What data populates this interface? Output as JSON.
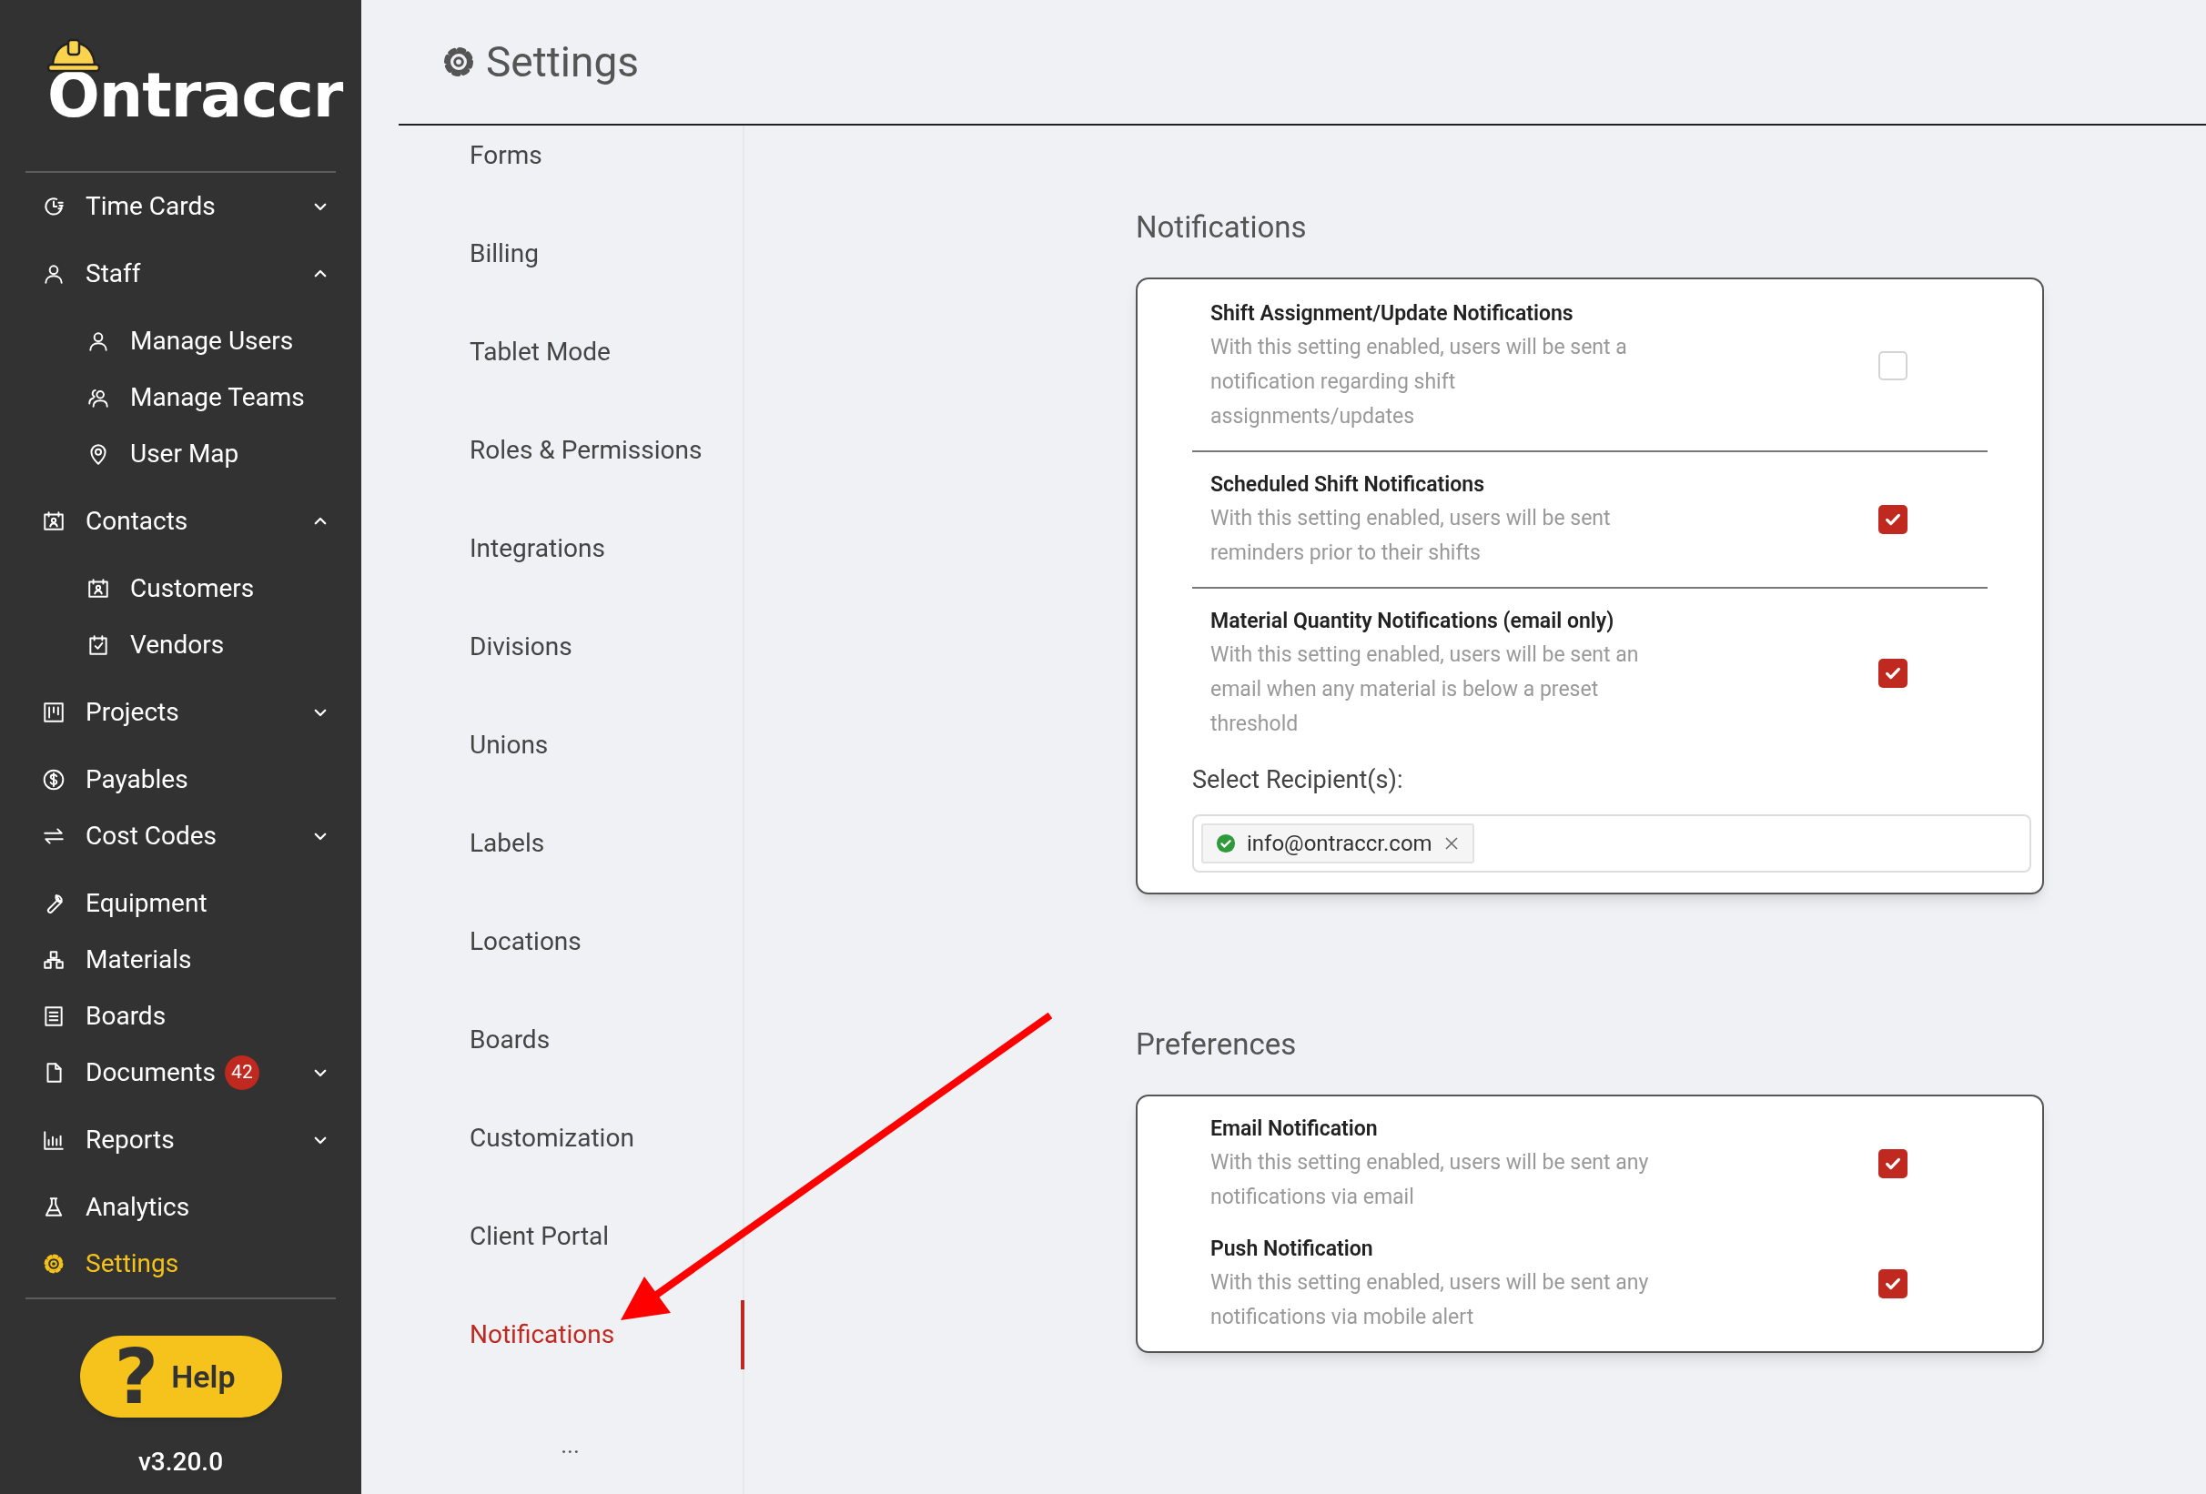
{
  "logo": {
    "text": "Ontraccr"
  },
  "sidebar": {
    "items": [
      {
        "label": "Time Cards",
        "expanded": false,
        "selected": false
      },
      {
        "label": "Staff",
        "expanded": true,
        "selected": false,
        "children": [
          {
            "label": "Manage Users",
            "selected": false
          },
          {
            "label": "Manage Teams",
            "selected": false
          },
          {
            "label": "User Map",
            "selected": false
          }
        ]
      },
      {
        "label": "Contacts",
        "expanded": true,
        "selected": false,
        "children": [
          {
            "label": "Customers",
            "selected": false
          },
          {
            "label": "Vendors",
            "selected": false
          }
        ]
      },
      {
        "label": "Projects",
        "expanded": false,
        "selected": false
      },
      {
        "label": "Payables",
        "selected": false
      },
      {
        "label": "Cost Codes",
        "expanded": false,
        "selected": false
      },
      {
        "label": "Equipment",
        "selected": false
      },
      {
        "label": "Materials",
        "selected": false
      },
      {
        "label": "Boards",
        "selected": false
      },
      {
        "label": "Documents",
        "expanded": false,
        "selected": false,
        "badge": "42"
      },
      {
        "label": "Reports",
        "expanded": false,
        "selected": false
      },
      {
        "label": "Analytics",
        "selected": false
      },
      {
        "label": "Settings",
        "selected": true
      }
    ],
    "help": {
      "icon_text": "?",
      "label": "Help"
    },
    "version": "v3.20.0"
  },
  "header": {
    "title": "Settings"
  },
  "settings_menu": {
    "items": [
      {
        "label": "Forms",
        "selected": false
      },
      {
        "label": "Billing",
        "selected": false
      },
      {
        "label": "Tablet Mode",
        "selected": false
      },
      {
        "label": "Roles & Permissions",
        "selected": false
      },
      {
        "label": "Integrations",
        "selected": false
      },
      {
        "label": "Divisions",
        "selected": false
      },
      {
        "label": "Unions",
        "selected": false
      },
      {
        "label": "Labels",
        "selected": false
      },
      {
        "label": "Locations",
        "selected": false
      },
      {
        "label": "Boards",
        "selected": false
      },
      {
        "label": "Customization",
        "selected": false
      },
      {
        "label": "Client Portal",
        "selected": false
      },
      {
        "label": "Notifications",
        "selected": true
      }
    ],
    "more": "..."
  },
  "sections": [
    {
      "title": "Notifications",
      "divided": true,
      "settings": [
        {
          "title": "Shift Assignment/Update Notifications",
          "description": "With this setting enabled, users will be sent a notification regarding shift assignments/updates",
          "checked": false
        },
        {
          "title": "Scheduled Shift Notifications",
          "description": "With this setting enabled, users will be sent reminders prior to their shifts",
          "checked": true
        },
        {
          "title": "Material Quantity Notifications (email only)",
          "description": "With this setting enabled, users will be sent an email when any material is below a preset threshold",
          "checked": true
        }
      ],
      "recipients": {
        "label": "Select Recipient(s):",
        "values": [
          {
            "text": "info@ontraccr.com"
          }
        ]
      }
    },
    {
      "title": "Preferences",
      "divided": false,
      "settings": [
        {
          "title": "Email Notification",
          "description": "With this setting enabled, users will be sent any notifications via email",
          "checked": true
        },
        {
          "title": "Push Notification",
          "description": "With this setting enabled, users will be sent any notifications via mobile alert",
          "checked": true
        }
      ]
    }
  ]
}
